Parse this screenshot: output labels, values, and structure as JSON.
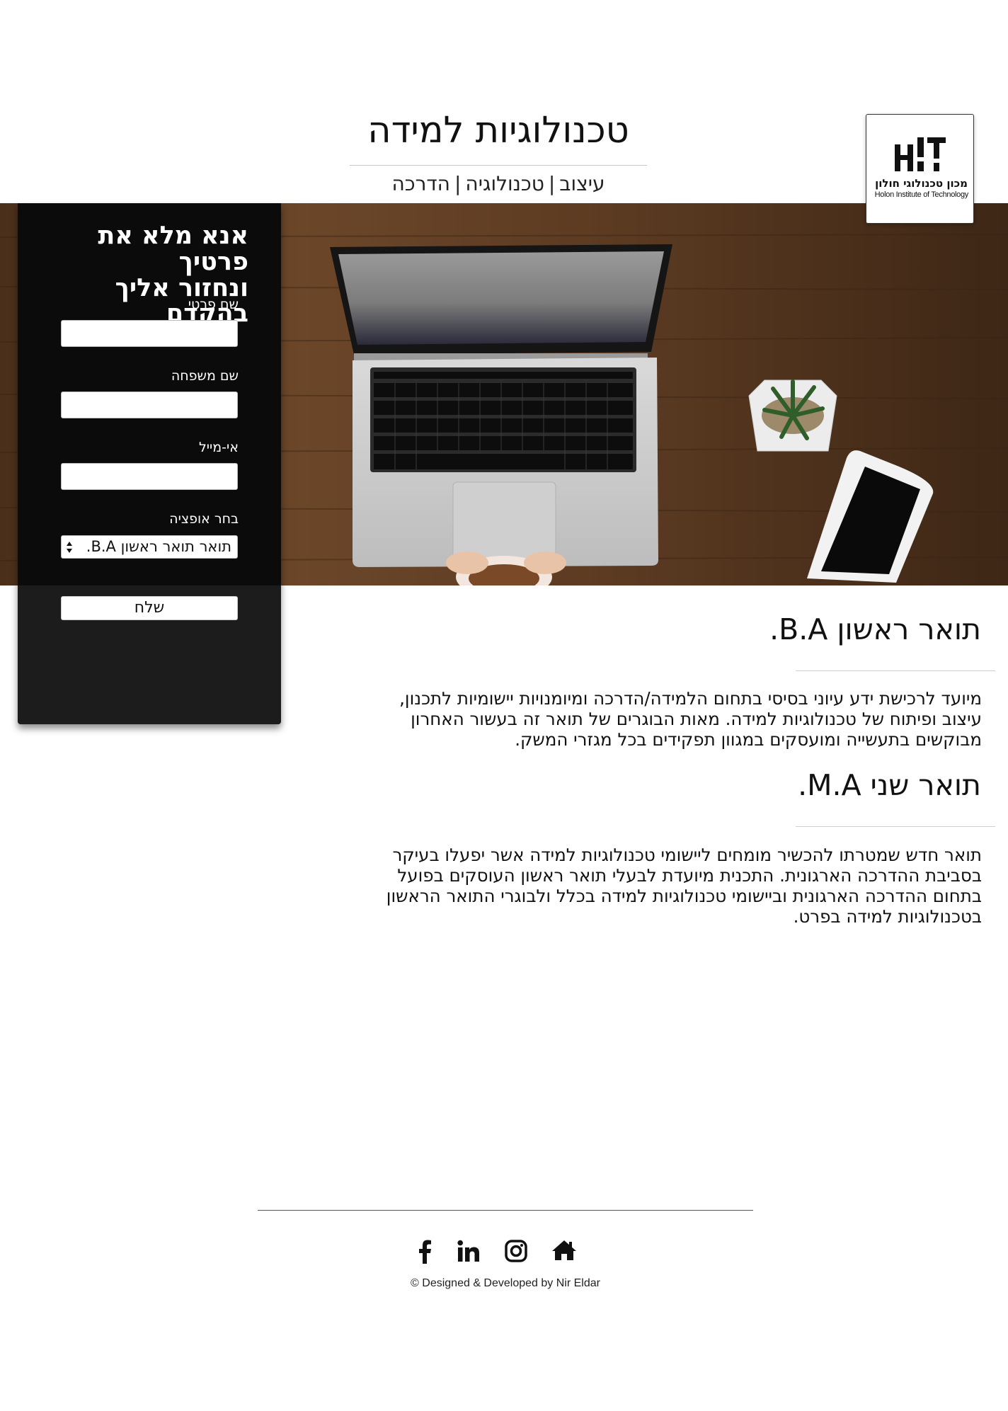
{
  "header": {
    "title": "טכנולוגיות למידה",
    "nav": [
      "עיצוב",
      "טכנולוגיה",
      "הדרכה"
    ],
    "nav_separator": "|"
  },
  "logo": {
    "mark": "Hit",
    "hebrew": "מכון טכנולוגי חולון",
    "english": "Holon Institute of Technology"
  },
  "form": {
    "title_line1": "אנא מלא את פרטיך",
    "title_line2": "ונחזור אליך בהקדם",
    "first_name_label": "שם פרטי",
    "first_name_value": "",
    "last_name_label": "שם משפחה",
    "last_name_value": "",
    "email_label": "אי-מייל",
    "email_value": "",
    "option_label": "בחר אופציה",
    "option_selected": "תואר תואר ראשון B.A.",
    "submit_label": "שלח"
  },
  "sections": [
    {
      "title": "תואר ראשון B.A.",
      "body": "מיועד לרכישת ידע עיוני בסיסי בתחום הלמידה/הדרכה ומיומנויות יישומיות לתכנון, עיצוב ופיתוח של טכנולוגיות למידה. מאות הבוגרים של תואר זה בעשור האחרון מבוקשים בתעשייה ומועסקים במגוון תפקידים בכל מגזרי המשק."
    },
    {
      "title": "תואר שני M.A.",
      "body": "תואר חדש שמטרתו להכשיר מומחים ליישומי טכנולוגיות למידה אשר יפעלו בעיקר בסביבת ההדרכה הארגונית. התכנית מיועדת לבעלי תואר ראשון העוסקים בפועל בתחום ההדרכה הארגונית וביישומי טכנולוגיות למידה בכלל ולבוגרי התואר הראשון בטכנולוגיות למידה בפרט."
    }
  ],
  "footer": {
    "social_icons": [
      "facebook-icon",
      "linkedin-icon",
      "instagram-icon",
      "home-icon"
    ],
    "credit": "© Designed & Developed by Nir Eldar"
  },
  "colors": {
    "card_bg": "#1c1c1c",
    "text": "#111111",
    "wood": "#5b3c25"
  }
}
